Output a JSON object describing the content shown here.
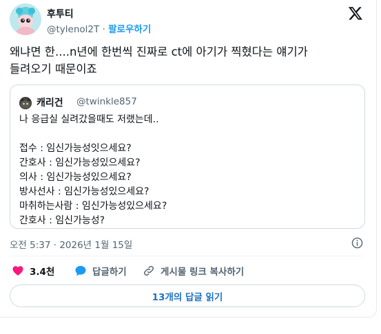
{
  "author": {
    "name": "후투티",
    "handle": "@tylenol2T",
    "separator": "·",
    "follow_label": "팔로우하기"
  },
  "tweet": {
    "lines": [
      "왜냐면 한....n년에 한번씩 진짜로 ct에 아기가 찍혔다는 얘기가",
      "들려오기 때문이죠"
    ]
  },
  "quote": {
    "name": "캐리건",
    "handle": "@twinkle857",
    "lines": [
      "나 응급실 실려갔을때도 저랬는데..",
      "",
      "접수 : 임신가능성잇으세요?",
      "간호사 : 임신가능성있으세요?",
      "의사 : 임신가능성있으세요?",
      "방사선사 : 임신가능성있으세요?",
      "마취하는사람 : 임신가능성있으세요?",
      "간호사 : 임신가능성?"
    ]
  },
  "timestamp": "오전 5:37 · 2026년 1월 15일",
  "actions": {
    "likes": "3.4천",
    "reply_label": "답글하기",
    "copy_link_label": "게시물 링크 복사하기"
  },
  "read_replies_label": "13개의 답글 읽기",
  "colors": {
    "accent": "#1d9bf0",
    "like": "#f91880",
    "border": "#cfd9de",
    "muted": "#536471"
  }
}
